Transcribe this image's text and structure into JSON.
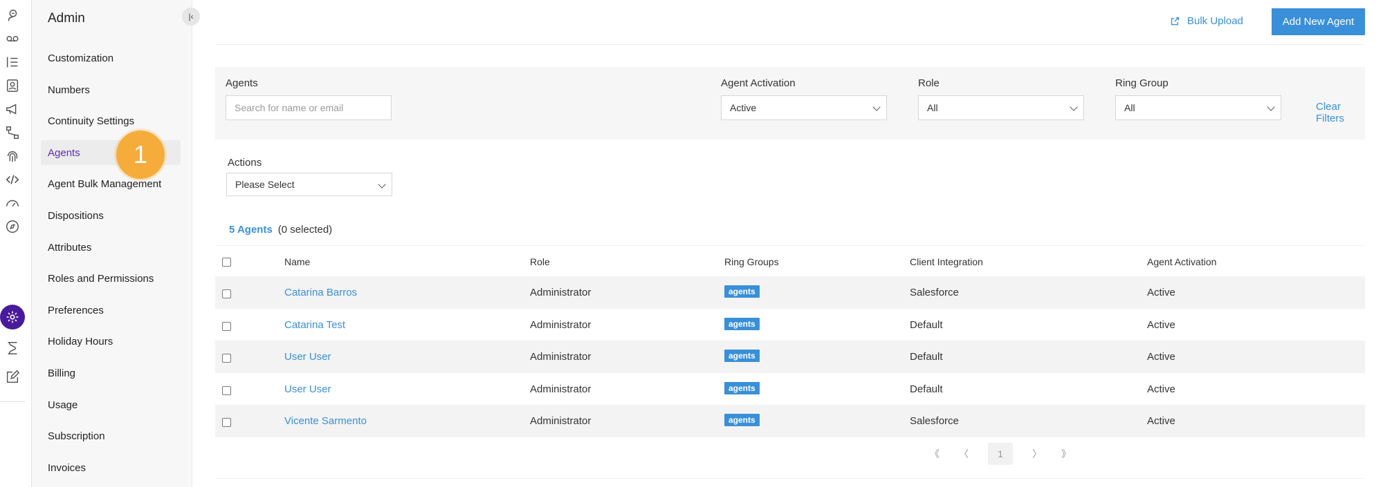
{
  "rail": {
    "icons": [
      "agent-icon",
      "voicemail-icon",
      "list-icon",
      "contacts-icon",
      "megaphone-icon",
      "flow-icon",
      "fingerprint-icon",
      "code-icon",
      "gauge-icon",
      "compass-icon",
      "settings-icon",
      "hourglass-icon",
      "edit-icon"
    ],
    "active_color": "#4a1a9c"
  },
  "sidebar": {
    "title": "Admin",
    "items": [
      {
        "label": "Customization"
      },
      {
        "label": "Numbers"
      },
      {
        "label": "Continuity Settings"
      },
      {
        "label": "Agents"
      },
      {
        "label": "Agent Bulk Management"
      },
      {
        "label": "Dispositions"
      },
      {
        "label": "Attributes"
      },
      {
        "label": "Roles and Permissions"
      },
      {
        "label": "Preferences"
      },
      {
        "label": "Holiday Hours"
      },
      {
        "label": "Billing"
      },
      {
        "label": "Usage"
      },
      {
        "label": "Subscription"
      },
      {
        "label": "Invoices"
      }
    ],
    "step_badge": "1"
  },
  "header": {
    "bulk_upload": "Bulk Upload",
    "add_new_agent": "Add New Agent"
  },
  "filters": {
    "agents_label": "Agents",
    "agents_placeholder": "Search for name or email",
    "activation_label": "Agent Activation",
    "activation_value": "Active",
    "role_label": "Role",
    "role_value": "All",
    "ring_group_label": "Ring Group",
    "ring_group_value": "All",
    "clear_filters": "Clear Filters",
    "actions_label": "Actions",
    "actions_value": "Please Select"
  },
  "summary": {
    "count": "5 Agents",
    "selected": "(0 selected)"
  },
  "table": {
    "headers": [
      "Name",
      "Role",
      "Ring Groups",
      "Client Integration",
      "Agent Activation"
    ],
    "rows": [
      {
        "name": "Catarina Barros",
        "role": "Administrator",
        "ring_group": "agents",
        "integration": "Salesforce",
        "activation": "Active"
      },
      {
        "name": "Catarina Test",
        "role": "Administrator",
        "ring_group": "agents",
        "integration": "Default",
        "activation": "Active"
      },
      {
        "name": "User User",
        "role": "Administrator",
        "ring_group": "agents",
        "integration": "Default",
        "activation": "Active"
      },
      {
        "name": "User User",
        "role": "Administrator",
        "ring_group": "agents",
        "integration": "Default",
        "activation": "Active"
      },
      {
        "name": "Vicente Sarmento",
        "role": "Administrator",
        "ring_group": "agents",
        "integration": "Salesforce",
        "activation": "Active"
      }
    ]
  },
  "pagination": {
    "first": "《",
    "prev": "〈",
    "page": "1",
    "next": "〉",
    "last": "》"
  },
  "colors": {
    "accent": "#3a8fd9",
    "active_nav": "#5b2bb5",
    "badge": "#f6ac3b"
  }
}
